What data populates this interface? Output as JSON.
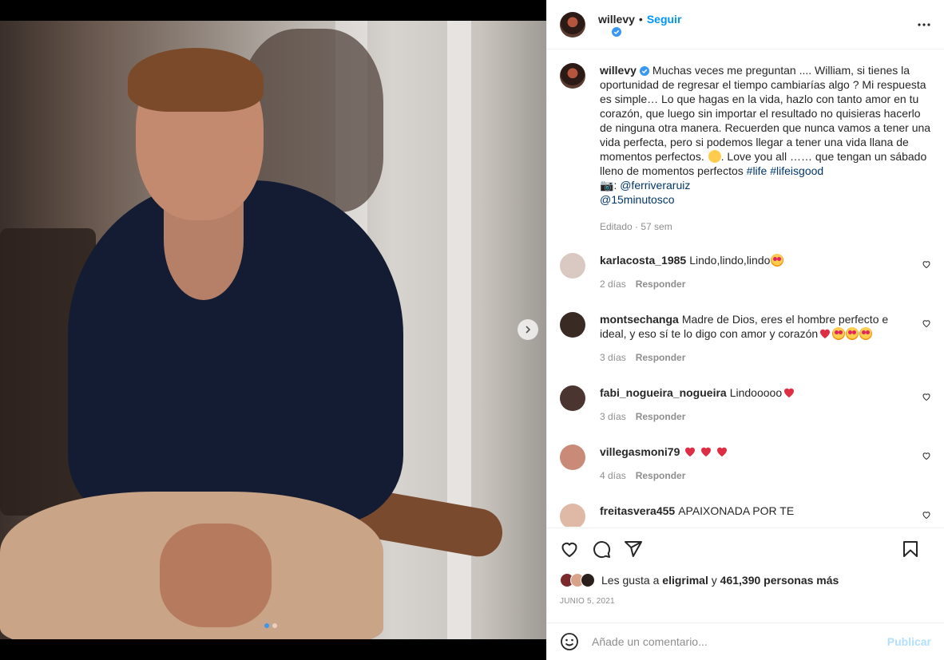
{
  "post": {
    "username": "willevy",
    "follow_label": "Seguir",
    "separator": "•",
    "caption_text": "Muchas veces me preguntan .... William, si tienes la oportunidad de regresar el tiempo cambiarías algo ? Mi respuesta es simple… Lo que hagas en la vida, hazlo con tanto amor en tu corazón, que luego sin importar el resultado no quisieras hacerlo de ninguna otra manera. Recuerden que nunca vamos a tener una vida perfecta, pero si podemos llegar a tener una vida llana de momentos perfectos.",
    "caption_text_2": ". Love you all …… que tengan un sábado lleno de momentos perfectos",
    "hashtag_1": "#life",
    "hashtag_2": "#lifeisgood",
    "camera_emoji": "📷",
    "photo_credit_sep": ":",
    "mention_1": "@ferriveraruiz",
    "mention_2": "@15minutosco",
    "edited": "Editado · 57 sem"
  },
  "comments": [
    {
      "username": "karlacosta_1985",
      "text": "Lindo,lindo,lindo",
      "time": "2 días",
      "reply": "Responder",
      "avatar_color": "#d9c9c2"
    },
    {
      "username": "montsechanga",
      "text": "Madre de Dios, eres el hombre perfecto e ideal, y eso sí te lo digo con amor y corazón",
      "time": "3 días",
      "reply": "Responder",
      "avatar_color": "#3a2a24"
    },
    {
      "username": "fabi_nogueira_nogueira",
      "text": "Lindooooo",
      "time": "3 días",
      "reply": "Responder",
      "avatar_color": "#4a3530"
    },
    {
      "username": "villegasmoni79",
      "text": "",
      "time": "4 días",
      "reply": "Responder",
      "avatar_color": "#c98a78"
    },
    {
      "username": "freitasvera455",
      "text": "APAIXONADA POR TE",
      "time": "",
      "reply": "",
      "avatar_color": "#e0b9a6"
    }
  ],
  "likes": {
    "prefix": "Les gusta a",
    "user": "eligrimal",
    "middle": "y",
    "count": "461,390 personas más"
  },
  "date": "JUNIO 5, 2021",
  "add_comment": {
    "placeholder": "Añade un comentario...",
    "publish": "Publicar"
  },
  "colors": {
    "accent": "#0095f6",
    "link": "#00376b",
    "muted": "#8e8e8e",
    "heart_red": "#ed4956",
    "publish_disabled": "#b2dffc"
  },
  "icons": {
    "header_more": "more-horizontal-icon",
    "carousel_next": "chevron-right-icon",
    "like": "heart-icon",
    "comment": "comment-icon",
    "share": "paper-plane-icon",
    "save": "bookmark-icon",
    "emoji": "smiley-icon"
  }
}
